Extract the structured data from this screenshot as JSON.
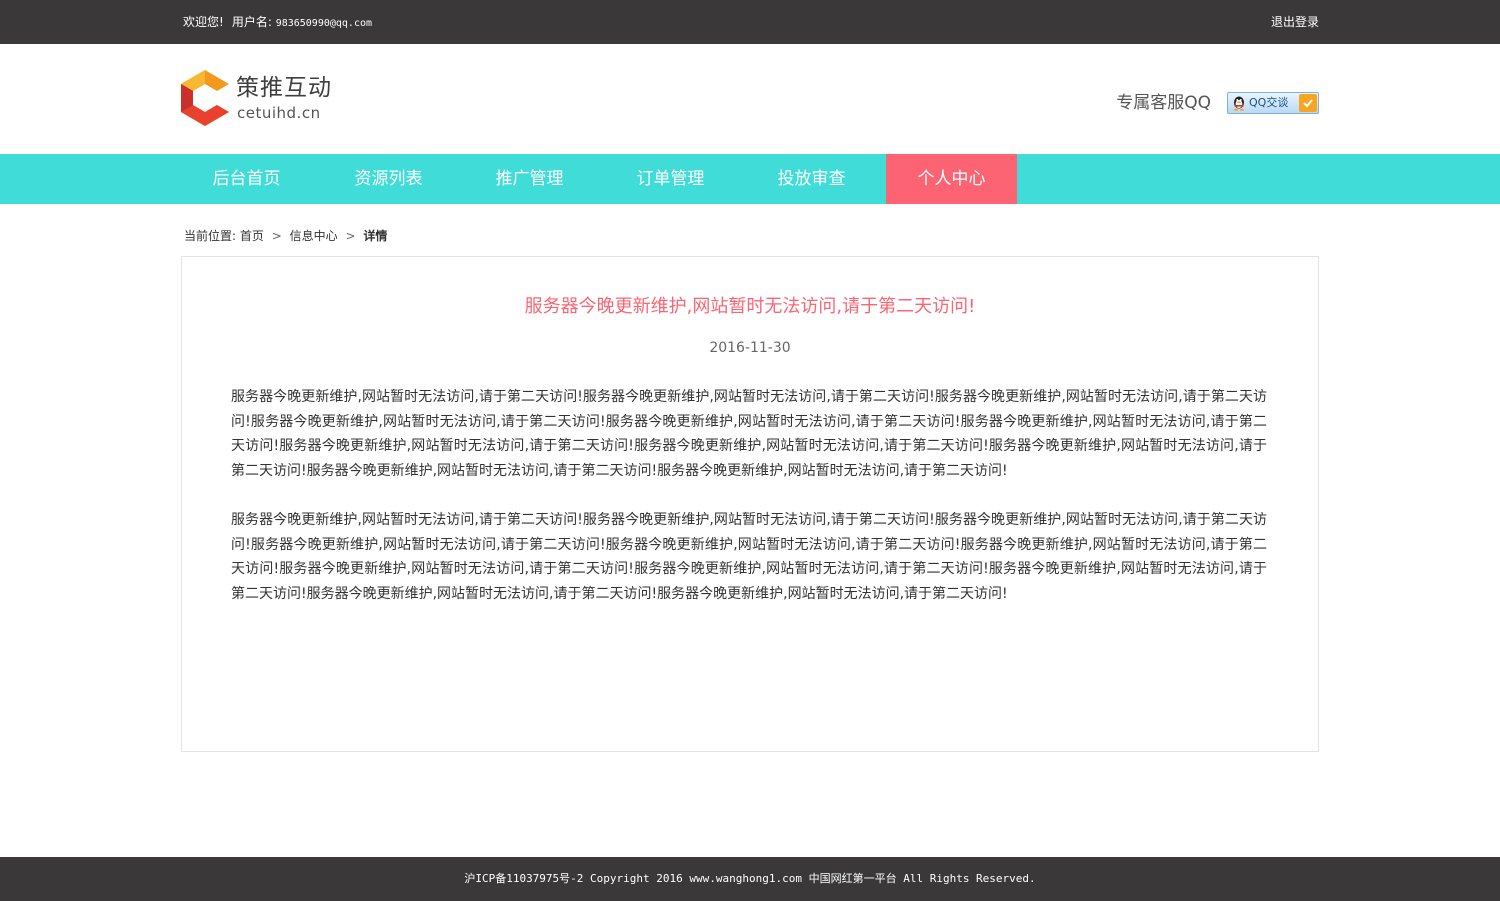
{
  "topbar": {
    "welcome": "欢迎您!",
    "username_label": "用户名:",
    "username": "983650990@qq.com",
    "logout": "退出登录"
  },
  "header": {
    "logo_cn": "策推互动",
    "logo_en": "cetuihd.cn",
    "service_label": "专属客服QQ",
    "qq_button": "QQ交谈"
  },
  "nav": {
    "items": [
      {
        "label": "后台首页",
        "active": false
      },
      {
        "label": "资源列表",
        "active": false
      },
      {
        "label": "推广管理",
        "active": false
      },
      {
        "label": "订单管理",
        "active": false
      },
      {
        "label": "投放审查",
        "active": false
      },
      {
        "label": "个人中心",
        "active": true
      }
    ]
  },
  "breadcrumb": {
    "label": "当前位置:",
    "items": [
      "首页",
      "信息中心"
    ],
    "current": "详情"
  },
  "article": {
    "title": "服务器今晚更新维护,网站暂时无法访问,请于第二天访问!",
    "date": "2016-11-30",
    "paragraphs": [
      "服务器今晚更新维护,网站暂时无法访问,请于第二天访问!服务器今晚更新维护,网站暂时无法访问,请于第二天访问!服务器今晚更新维护,网站暂时无法访问,请于第二天访问!服务器今晚更新维护,网站暂时无法访问,请于第二天访问!服务器今晚更新维护,网站暂时无法访问,请于第二天访问!服务器今晚更新维护,网站暂时无法访问,请于第二天访问!服务器今晚更新维护,网站暂时无法访问,请于第二天访问!服务器今晚更新维护,网站暂时无法访问,请于第二天访问!服务器今晚更新维护,网站暂时无法访问,请于第二天访问!服务器今晚更新维护,网站暂时无法访问,请于第二天访问!服务器今晚更新维护,网站暂时无法访问,请于第二天访问!",
      "服务器今晚更新维护,网站暂时无法访问,请于第二天访问!服务器今晚更新维护,网站暂时无法访问,请于第二天访问!服务器今晚更新维护,网站暂时无法访问,请于第二天访问!服务器今晚更新维护,网站暂时无法访问,请于第二天访问!服务器今晚更新维护,网站暂时无法访问,请于第二天访问!服务器今晚更新维护,网站暂时无法访问,请于第二天访问!服务器今晚更新维护,网站暂时无法访问,请于第二天访问!服务器今晚更新维护,网站暂时无法访问,请于第二天访问!服务器今晚更新维护,网站暂时无法访问,请于第二天访问!服务器今晚更新维护,网站暂时无法访问,请于第二天访问!服务器今晚更新维护,网站暂时无法访问,请于第二天访问!"
    ]
  },
  "footer": {
    "text": "沪ICP备11037975号-2 Copyright 2016 www.wanghong1.com 中国网红第一平台 All Rights Reserved."
  },
  "colors": {
    "topbar_bg": "#3a3838",
    "nav_bg": "#40dcd8",
    "nav_active_bg": "#fd6473",
    "title_color": "#fd6473",
    "logo_orange": "#f39a1e",
    "logo_red": "#e9412f"
  }
}
